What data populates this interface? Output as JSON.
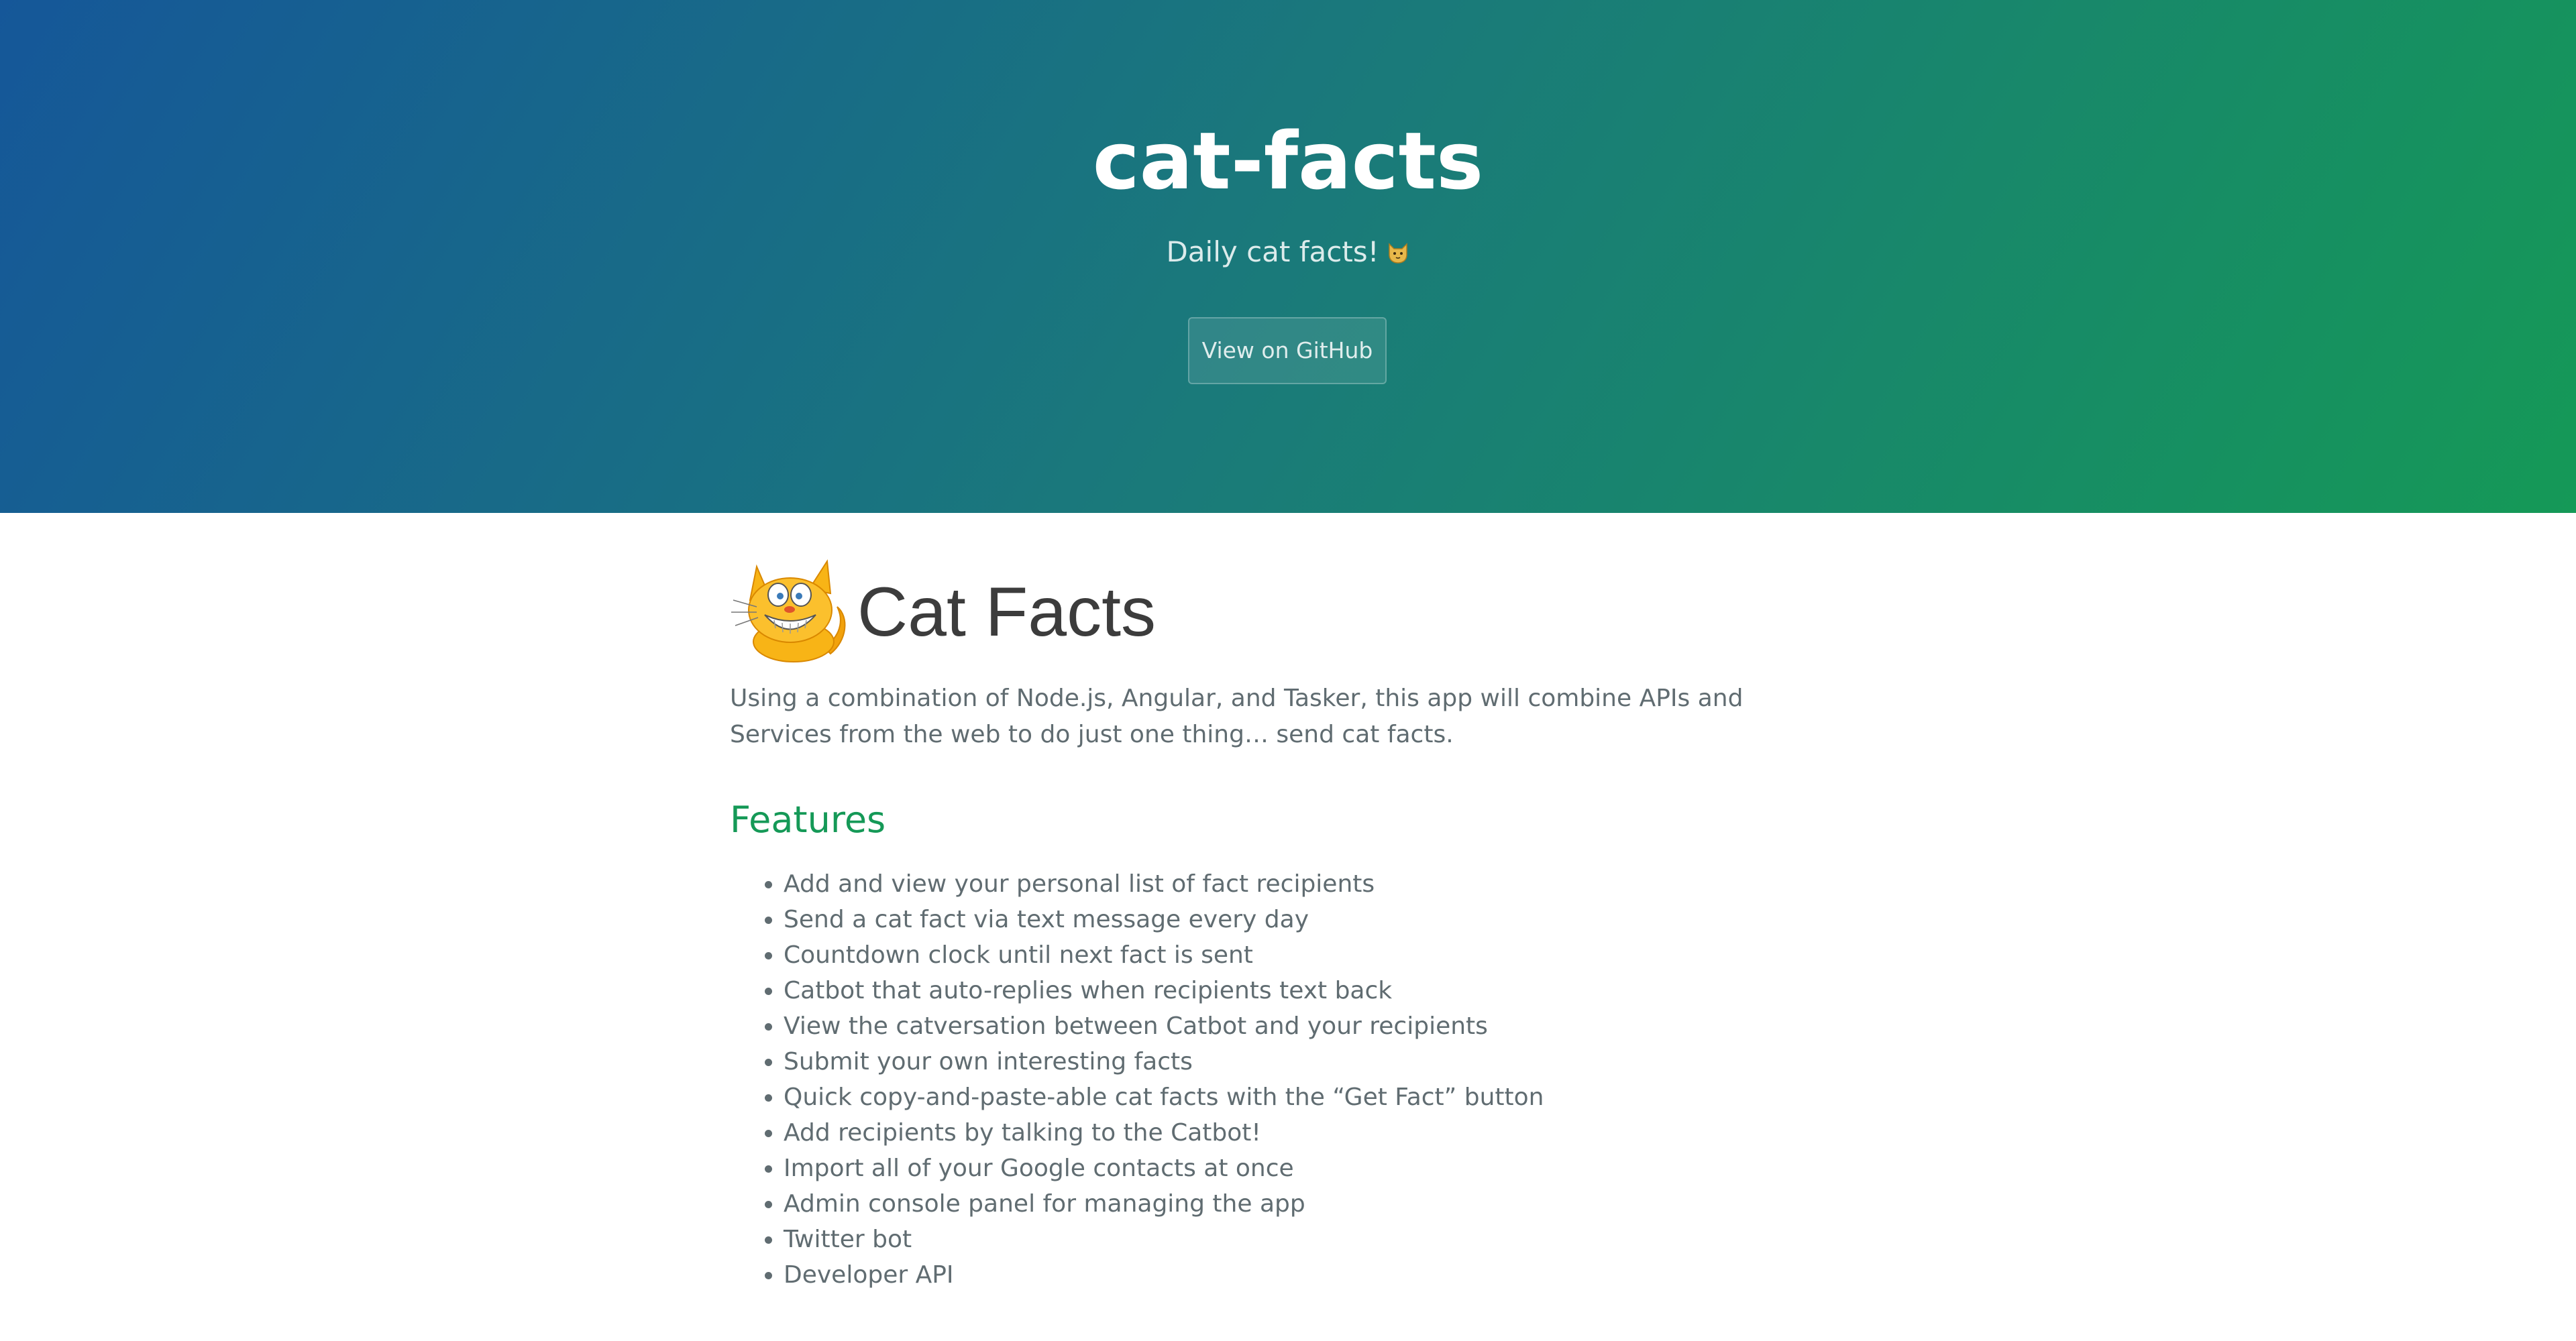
{
  "header": {
    "title": "cat-facts",
    "tagline": "Daily cat facts!",
    "tagline_icon": "cat-face-emoji",
    "github_button": "View on GitHub",
    "gradient_start": "#155799",
    "gradient_end": "#159957"
  },
  "logo": {
    "text": "Cat Facts",
    "icon": "grinning-orange-cat-icon"
  },
  "intro": "Using a combination of Node.js, Angular, and Tasker, this app will combine APIs and Services from the web to do just one thing… send cat facts.",
  "features": {
    "heading": "Features",
    "items": [
      "Add and view your personal list of fact recipients",
      "Send a cat fact via text message every day",
      "Countdown clock until next fact is sent",
      "Catbot that auto-replies when recipients text back",
      "View the catversation between Catbot and your recipients",
      "Submit your own interesting facts",
      "Quick copy-and-paste-able cat facts with the “Get Fact” button",
      "Add recipients by talking to the Catbot!",
      "Import all of your Google contacts at once",
      "Admin console panel for managing the app",
      "Twitter bot",
      "Developer API"
    ]
  },
  "colors": {
    "heading_accent": "#159957",
    "body_text": "#606c71"
  }
}
